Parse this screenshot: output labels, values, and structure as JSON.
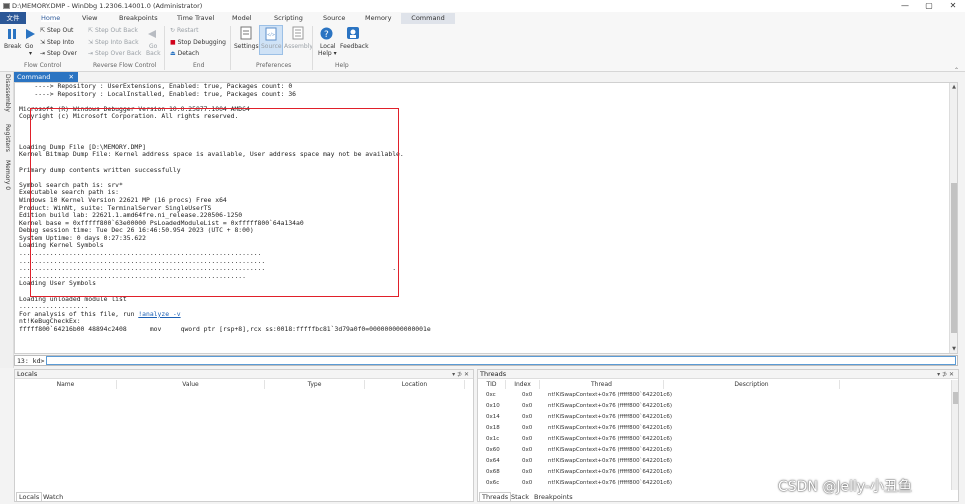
{
  "window": {
    "title": "D:\\MEMORY.DMP - WinDbg 1.2306.14001.0 (Administrator)",
    "minimize": "—",
    "restore": "▢",
    "close": "✕"
  },
  "menu": {
    "file": "文件",
    "items": [
      "Home",
      "View",
      "Breakpoints",
      "Time Travel",
      "Model",
      "Scripting",
      "Source",
      "Memory"
    ],
    "context_tab": "Command"
  },
  "ribbon": {
    "break": "Break",
    "go": "Go",
    "go_sub": "▾",
    "step_out": "Step Out",
    "step_into": "Step Into",
    "step_over": "Step Over",
    "step_out_back": "Step Out Back",
    "step_into_back": "Step Into Back",
    "step_over_back": "Step Over Back",
    "go_back": "Go",
    "go_back2": "Back",
    "restart": "Restart",
    "stop_debugging": "Stop Debugging",
    "detach": "Detach",
    "settings": "Settings",
    "source": "Source",
    "assembly": "Assembly",
    "local_help": "Local",
    "local_help2": "Help ▾",
    "feedback": "Feedback",
    "groups": {
      "flow_control": "Flow Control",
      "reverse_flow_control": "Reverse Flow Control",
      "end": "End",
      "preferences": "Preferences",
      "help": "Help"
    }
  },
  "left_dock": {
    "tabs": [
      "Disassembly",
      "Registers",
      "Memory 0"
    ]
  },
  "command_window": {
    "tab_label": "Command",
    "tab_close": "✕",
    "lines": [
      "    ----> Repository : UserExtensions, Enabled: true, Packages count: 0",
      "    ----> Repository : LocalInstalled, Enabled: true, Packages count: 36",
      "",
      "Microsoft (R) Windows Debugger Version 10.0.25877.1004 AMD64",
      "Copyright (c) Microsoft Corporation. All rights reserved.",
      "",
      "",
      "",
      "Loading Dump File [D:\\MEMORY.DMP]",
      "Kernel Bitmap Dump File: Kernel address space is available, User address space may not be available.",
      "",
      "Primary dump contents written successfully",
      "",
      "Symbol search path is: srv*",
      "Executable search path is:",
      "Windows 10 Kernel Version 22621 MP (16 procs) Free x64",
      "Product: WinNt, suite: TerminalServer SingleUserTS",
      "Edition build lab: 22621.1.amd64fre.ni_release.220506-1250",
      "Kernel base = 0xfffff800`63e00000 PsLoadedModuleList = 0xfffff800`64a134a0",
      "Debug session time: Tue Dec 26 16:46:50.954 2023 (UTC + 8:00)",
      "System Uptime: 0 days 0:27:35.622",
      "Loading Kernel Symbols",
      "...............................................................",
      "................................................................",
      "................................................................                                 .",
      "...........................................................",
      "Loading User Symbols",
      "",
      "Loading unloaded module list",
      "..................",
      "For analysis of this file, run ",
      "nt!KeBugCheckEx:",
      "fffff800`64216b00 48894c2408      mov     qword ptr [rsp+8],rcx ss:0018:fffffbc81`3d79a0f0=000000000000001e"
    ],
    "analyze_link": "!analyze -v",
    "prompt": "13: kd>"
  },
  "locals_panel": {
    "title": "Locals",
    "controls": "▾ ⊅ ✕",
    "columns": [
      "Name",
      "Value",
      "Type",
      "Location"
    ],
    "tabs": [
      "Locals",
      "Watch"
    ]
  },
  "threads_panel": {
    "title": "Threads",
    "controls": "▾ ⊅ ✕",
    "columns": [
      "TID",
      "Index",
      "Thread",
      "Description"
    ],
    "rows": [
      {
        "tid": "0xc",
        "index": "0x0",
        "thread": "nt!KiSwapContext+0x76 (fffff800`642201c6)"
      },
      {
        "tid": "0x10",
        "index": "0x0",
        "thread": "nt!KiSwapContext+0x76 (fffff800`642201c6)"
      },
      {
        "tid": "0x14",
        "index": "0x0",
        "thread": "nt!KiSwapContext+0x76 (fffff800`642201c6)"
      },
      {
        "tid": "0x18",
        "index": "0x0",
        "thread": "nt!KiSwapContext+0x76 (fffff800`642201c6)"
      },
      {
        "tid": "0x1c",
        "index": "0x0",
        "thread": "nt!KiSwapContext+0x76 (fffff800`642201c6)"
      },
      {
        "tid": "0x60",
        "index": "0x0",
        "thread": "nt!KiSwapContext+0x76 (fffff800`642201c6)"
      },
      {
        "tid": "0x64",
        "index": "0x0",
        "thread": "nt!KiSwapContext+0x76 (fffff800`642201c6)"
      },
      {
        "tid": "0x68",
        "index": "0x0",
        "thread": "nt!KiSwapContext+0x76 (fffff800`642201c6)"
      },
      {
        "tid": "0x6c",
        "index": "0x0",
        "thread": "nt!KiSwapContext+0x76 (fffff800`642201c6)"
      }
    ],
    "tabs": [
      "Threads",
      "Stack",
      "Breakpoints"
    ]
  },
  "watermark": "CSDN @Jelly-小丑鱼",
  "colors": {
    "accent": "#2b74c2",
    "highlight_box": "#e0202a",
    "file_tab": "#2b5797"
  }
}
